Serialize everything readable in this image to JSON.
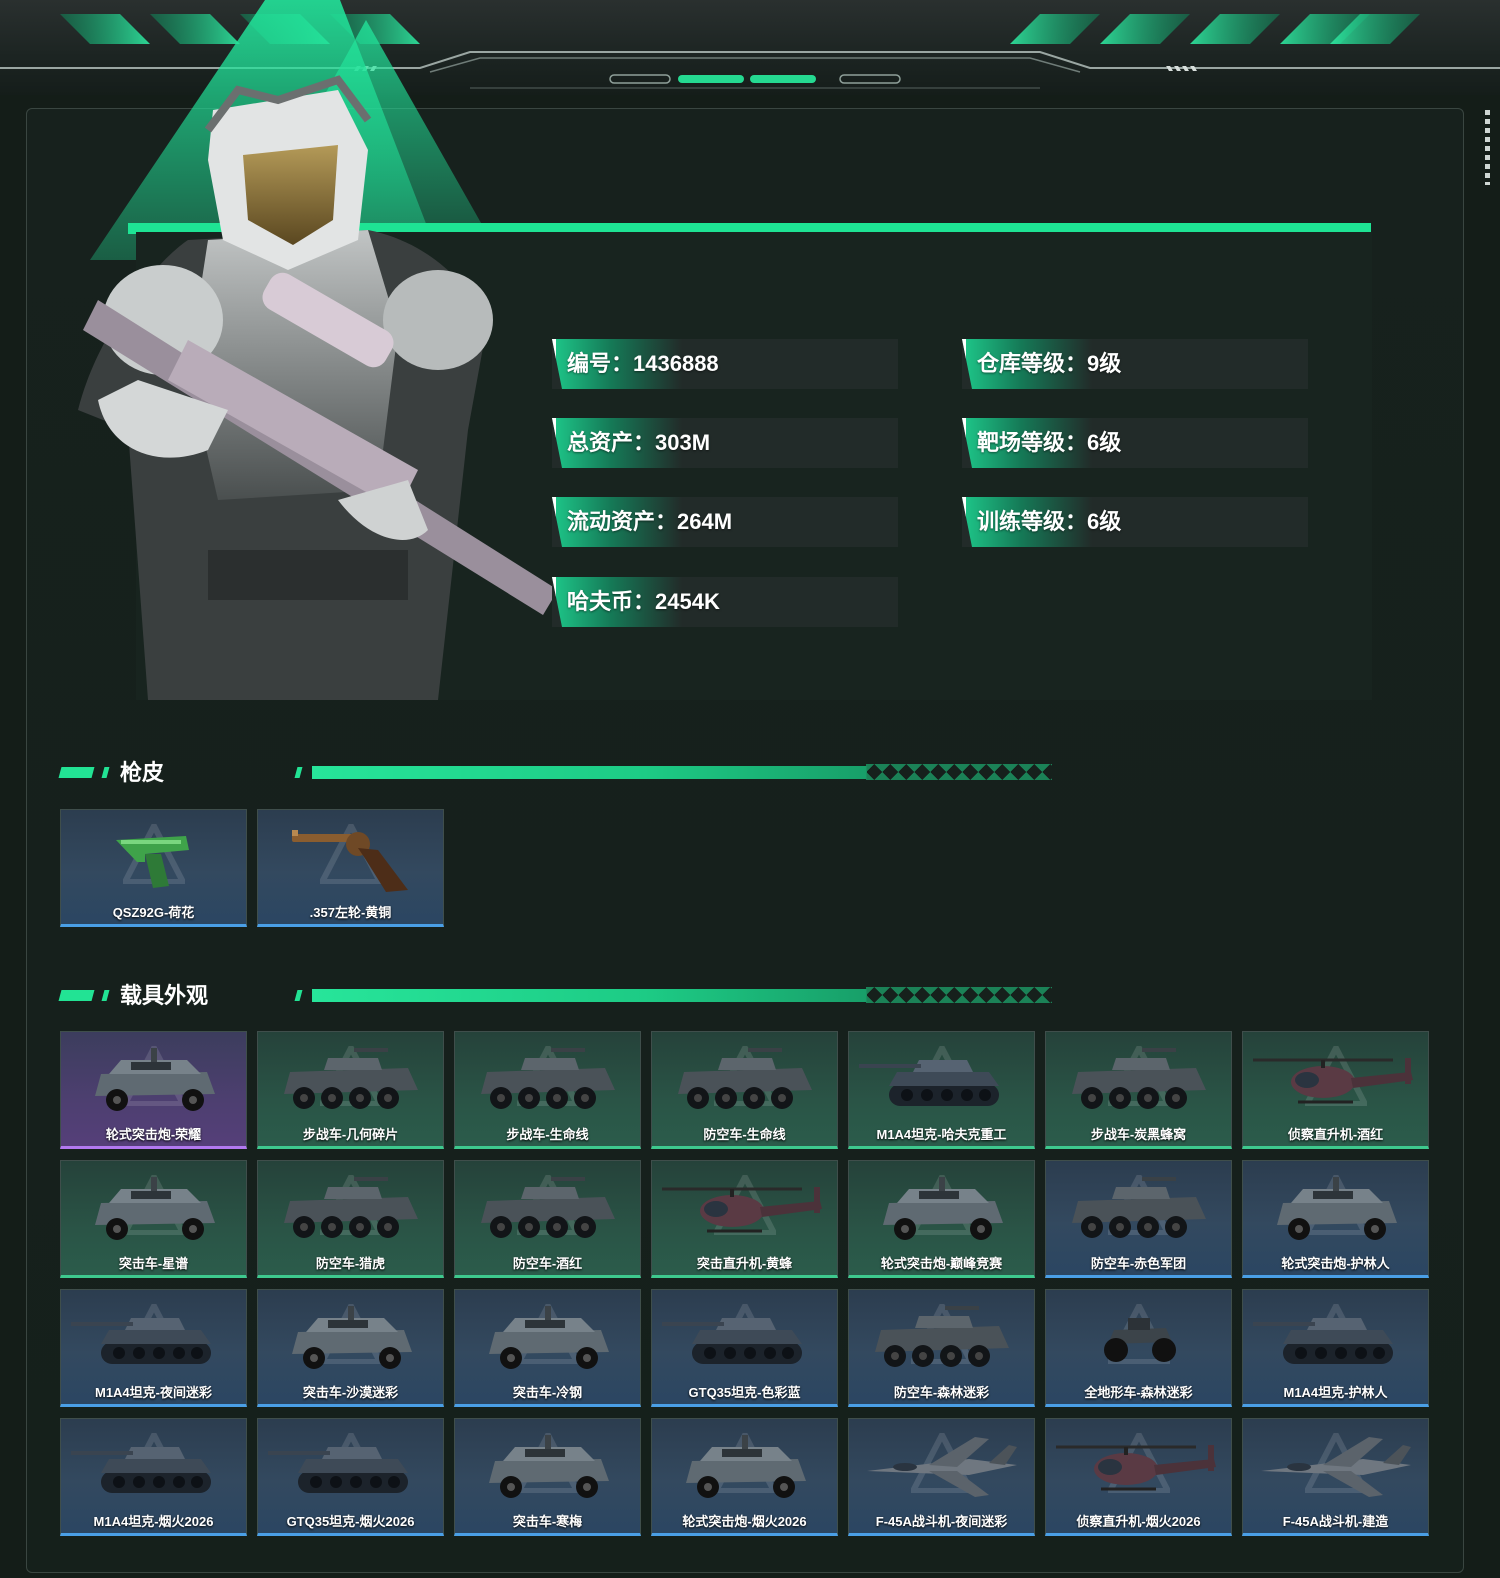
{
  "profile": {
    "stats": [
      {
        "label": "编号：",
        "value": "1436888"
      },
      {
        "label": "仓库等级：",
        "value": "9级"
      },
      {
        "label": "总资产：",
        "value": "303M"
      },
      {
        "label": "靶场等级：",
        "value": "6级"
      },
      {
        "label": "流动资产：",
        "value": "264M"
      },
      {
        "label": "训练等级：",
        "value": "6级"
      },
      {
        "label": "哈夫币：",
        "value": "2454K"
      }
    ]
  },
  "colors": {
    "accent": "#1ee494",
    "rarity_blue": "#4a9fe6",
    "rarity_green": "#3ec98e",
    "rarity_purple": "#b279f0"
  },
  "gun_skins": {
    "title": "枪皮",
    "items": [
      {
        "name": "QSZ92G-荷花",
        "rarity": "blue",
        "icon": "pistol-icon"
      },
      {
        "name": ".357左轮-黄铜",
        "rarity": "blue",
        "icon": "revolver-icon"
      }
    ]
  },
  "vehicle_skins": {
    "title": "载具外观",
    "items": [
      {
        "name": "轮式突击炮-荣耀",
        "rarity": "purple",
        "icon": "armored-car-icon"
      },
      {
        "name": "步战车-几何碎片",
        "rarity": "green",
        "icon": "apc-icon"
      },
      {
        "name": "步战车-生命线",
        "rarity": "green",
        "icon": "apc-icon"
      },
      {
        "name": "防空车-生命线",
        "rarity": "green",
        "icon": "apc-icon"
      },
      {
        "name": "M1A4坦克-哈夫克重工",
        "rarity": "green",
        "icon": "tank-icon"
      },
      {
        "name": "步战车-炭黑蜂窝",
        "rarity": "green",
        "icon": "apc-icon"
      },
      {
        "name": "侦察直升机-酒红",
        "rarity": "green",
        "icon": "helicopter-icon"
      },
      {
        "name": "突击车-星谱",
        "rarity": "green",
        "icon": "armored-car-icon"
      },
      {
        "name": "防空车-猎虎",
        "rarity": "green",
        "icon": "apc-icon"
      },
      {
        "name": "防空车-酒红",
        "rarity": "green",
        "icon": "apc-icon"
      },
      {
        "name": "突击直升机-黄蜂",
        "rarity": "green",
        "icon": "helicopter-icon"
      },
      {
        "name": "轮式突击炮-巅峰竞赛",
        "rarity": "green",
        "icon": "armored-car-icon"
      },
      {
        "name": "防空车-赤色军团",
        "rarity": "blue",
        "icon": "apc-icon"
      },
      {
        "name": "轮式突击炮-护林人",
        "rarity": "blue",
        "icon": "armored-car-icon"
      },
      {
        "name": "M1A4坦克-夜间迷彩",
        "rarity": "blue",
        "icon": "tank-icon"
      },
      {
        "name": "突击车-沙漠迷彩",
        "rarity": "blue",
        "icon": "armored-car-icon"
      },
      {
        "name": "突击车-冷钢",
        "rarity": "blue",
        "icon": "armored-car-icon"
      },
      {
        "name": "GTQ35坦克-色彩蓝",
        "rarity": "blue",
        "icon": "tank-icon"
      },
      {
        "name": "防空车-森林迷彩",
        "rarity": "blue",
        "icon": "apc-icon"
      },
      {
        "name": "全地形车-森林迷彩",
        "rarity": "blue",
        "icon": "atv-icon"
      },
      {
        "name": "M1A4坦克-护林人",
        "rarity": "blue",
        "icon": "tank-icon"
      },
      {
        "name": "M1A4坦克-烟火2026",
        "rarity": "blue",
        "icon": "tank-icon"
      },
      {
        "name": "GTQ35坦克-烟火2026",
        "rarity": "blue",
        "icon": "tank-icon"
      },
      {
        "name": "突击车-寒梅",
        "rarity": "blue",
        "icon": "armored-car-icon"
      },
      {
        "name": "轮式突击炮-烟火2026",
        "rarity": "blue",
        "icon": "armored-car-icon"
      },
      {
        "name": "F-45A战斗机-夜间迷彩",
        "rarity": "blue",
        "icon": "fighter-jet-icon"
      },
      {
        "name": "侦察直升机-烟火2026",
        "rarity": "blue",
        "icon": "helicopter-icon"
      },
      {
        "name": "F-45A战斗机-建造",
        "rarity": "blue",
        "icon": "fighter-jet-icon"
      }
    ]
  }
}
